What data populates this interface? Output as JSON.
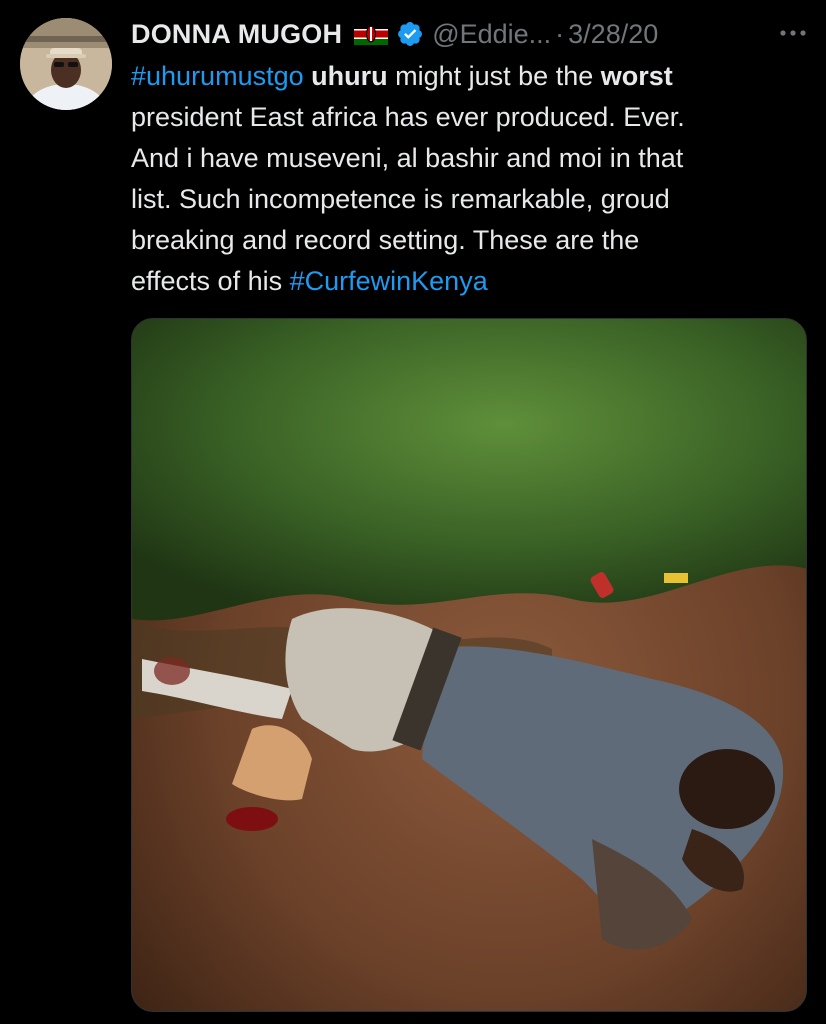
{
  "tweet": {
    "display_name": "DONNA MUGOH",
    "handle": "@Eddie...",
    "separator": "·",
    "date": "3/28/20",
    "flag_icon": "kenya-flag-icon",
    "verified_icon": "verified-badge-icon",
    "more_icon": "more-options-icon",
    "colors": {
      "background": "#000000",
      "text": "#e7e9ea",
      "muted": "#71767b",
      "link": "#1d9bf0"
    },
    "body": {
      "hashtag_uhurumustgo": "#uhurumustgo",
      "bold_uhuru": "uhuru",
      "text_1": " might just be the ",
      "bold_worst": "worst",
      "line_2": "president East africa has ever produced. Ever.",
      "line_3": "And i have museveni, al bashir and moi in that",
      "line_4": "list. Such incompetence is remarkable, groud",
      "line_5": "breaking and record setting.  These are the",
      "line_6_prefix": "effects of his ",
      "hashtag_curfew": "#CurfewinKenya"
    },
    "media": {
      "type": "photo"
    }
  }
}
